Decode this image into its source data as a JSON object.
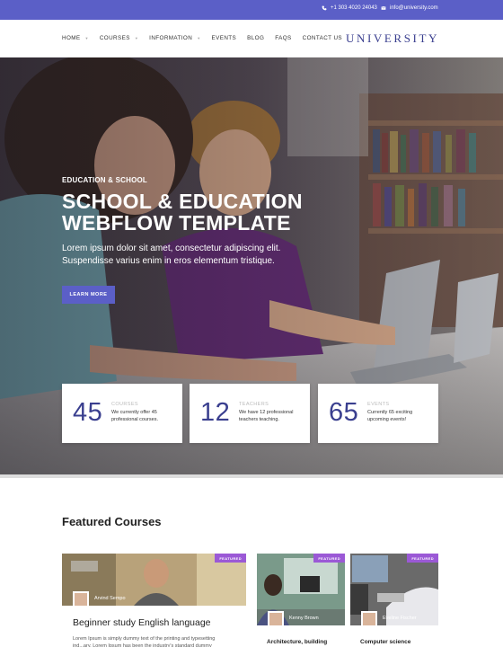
{
  "topbar": {
    "phone": "+1 303 4020 24043",
    "email": "info@university.com",
    "background": "#5b5fc7"
  },
  "nav": {
    "items": [
      {
        "label": "HOME",
        "dropdown": true
      },
      {
        "label": "COURSES",
        "dropdown": true
      },
      {
        "label": "INFORMATION",
        "dropdown": true
      },
      {
        "label": "EVENTS",
        "dropdown": false
      },
      {
        "label": "BLOG",
        "dropdown": false
      },
      {
        "label": "FAQS",
        "dropdown": false
      },
      {
        "label": "CONTACT US",
        "dropdown": false
      }
    ],
    "logo": "UNIVERSITY"
  },
  "hero": {
    "eyebrow": "EDUCATION & SCHOOL",
    "title": "SCHOOL & EDUCATION WEBFLOW TEMPLATE",
    "subtitle": "Lorem ipsum dolor sit amet, consectetur adipiscing elit. Suspendisse varius enim in eros elementum tristique.",
    "cta": "LEARN MORE"
  },
  "stats": [
    {
      "number": "45",
      "label": "COURSES",
      "desc": "We currently offer 45 professional courses."
    },
    {
      "number": "12",
      "label": "TEACHERS",
      "desc": "We have 12 professional teachers teaching."
    },
    {
      "number": "65",
      "label": "EVENTS",
      "desc": "Currently 65 exciting upcoming events!"
    }
  ],
  "featured": {
    "title": "Featured Courses",
    "courses": [
      {
        "badge": "FEATURED",
        "author": "Arvind Sempo",
        "title": "Beginner study English language",
        "desc": "Lorem Ipsum is simply dummy text of the printing and typesetting ind...ary. Lorem Ipsum has been the industry's standard dummy"
      },
      {
        "badge": "FEATURED",
        "author": "Kenny Brown",
        "title": "Architecture, building"
      },
      {
        "badge": "FEATURED",
        "author": "Eveline Fischer",
        "title": "Computer science"
      }
    ]
  },
  "colors": {
    "accent": "#5b5fc7",
    "brand_text": "#3a3f8f",
    "badge": "#9b59d6"
  }
}
